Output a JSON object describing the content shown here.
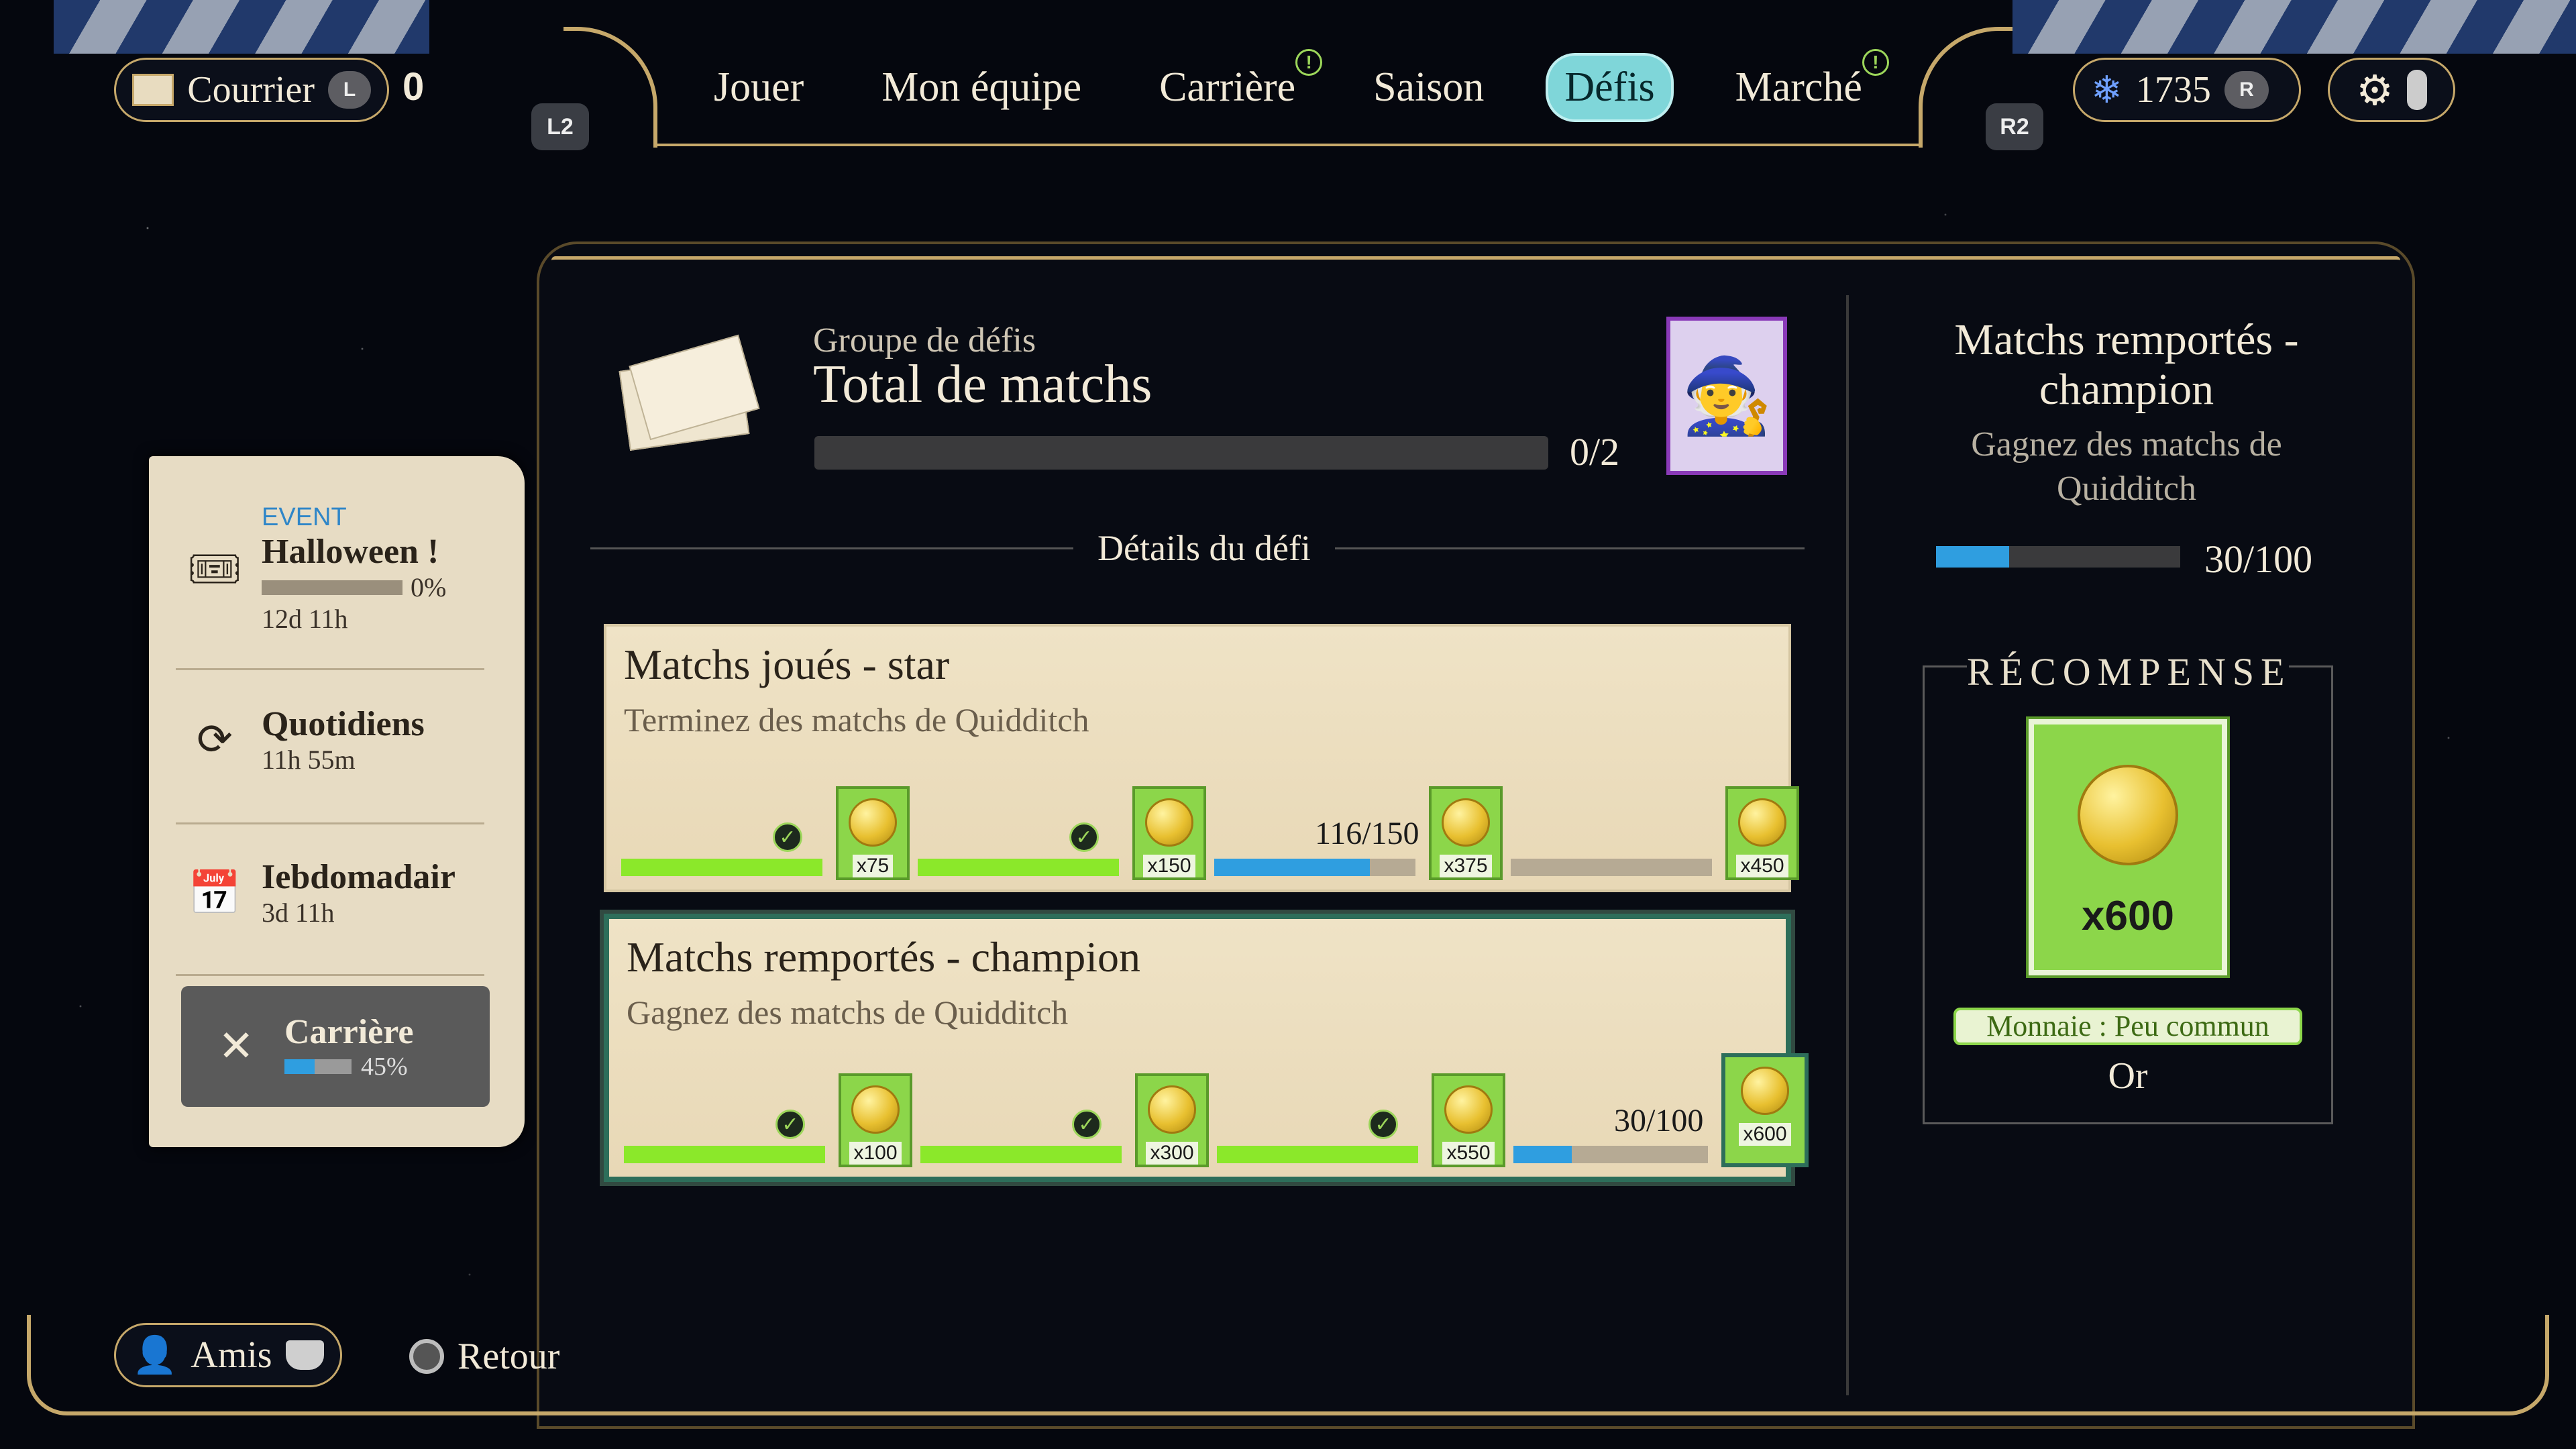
{
  "top": {
    "mail_label": "Courrier",
    "mail_btn": "L",
    "mail_count": "0",
    "l2": "L2",
    "r2": "R2",
    "currency_value": "1735",
    "currency_btn": "R",
    "currency_icon": "crystal-icon",
    "settings_icon": "gear-icon"
  },
  "nav": {
    "items": [
      {
        "label": "Jouer",
        "active": false,
        "notif": false
      },
      {
        "label": "Mon équipe",
        "active": false,
        "notif": false
      },
      {
        "label": "Carrière",
        "active": false,
        "notif": true
      },
      {
        "label": "Saison",
        "active": false,
        "notif": false
      },
      {
        "label": "Défis",
        "active": true,
        "notif": false
      },
      {
        "label": "Marché",
        "active": false,
        "notif": true
      }
    ],
    "notif_symbol": "!"
  },
  "sidebar": {
    "event_tag": "EVENT",
    "event_title": "Halloween !",
    "event_progress_text": "0%",
    "event_progress": 0,
    "event_time": "12d 11h",
    "daily_title": "Quotidiens",
    "daily_time": "11h 55m",
    "weekly_title": "Iebdomadair",
    "weekly_time": "3d 11h",
    "career_title": "Carrière",
    "career_progress_text": "45%",
    "career_progress": 0.45
  },
  "group": {
    "label": "Groupe de défis",
    "title": "Total de matchs",
    "progress_text": "0/2",
    "progress": 0
  },
  "details_label": "Détails du défi",
  "challenges": [
    {
      "title": "Matchs joués - star",
      "subtitle": "Terminez des matchs de Quidditch",
      "tiers": [
        {
          "reward": "x75",
          "progress": 1,
          "done": true,
          "text": ""
        },
        {
          "reward": "x150",
          "progress": 1,
          "done": true,
          "text": ""
        },
        {
          "reward": "x375",
          "progress": 0.773,
          "done": false,
          "text": "116/150"
        },
        {
          "reward": "x450",
          "progress": 0,
          "done": false,
          "text": ""
        }
      ]
    },
    {
      "title": "Matchs remportés - champion",
      "subtitle": "Gagnez des matchs de Quidditch",
      "tiers": [
        {
          "reward": "x100",
          "progress": 1,
          "done": true,
          "text": ""
        },
        {
          "reward": "x300",
          "progress": 1,
          "done": true,
          "text": ""
        },
        {
          "reward": "x550",
          "progress": 1,
          "done": true,
          "text": ""
        },
        {
          "reward": "x600",
          "progress": 0.3,
          "done": false,
          "text": "30/100"
        }
      ]
    }
  ],
  "detail": {
    "title": "Matchs remportés - champion",
    "subtitle": "Gagnez des matchs de Quidditch",
    "progress_text": "30/100",
    "progress": 0.3,
    "reward_header": "RÉCOMPENSE",
    "reward_amount": "x600",
    "reward_tag": "Monnaie : Peu commun",
    "reward_type": "Or"
  },
  "bottom": {
    "friends_label": "Amis",
    "back_label": "Retour"
  },
  "colors": {
    "gold_trim": "#c6a86a",
    "active_tab": "#7fd6d9",
    "progress_green": "#8be82a",
    "progress_blue": "#2f9ee0",
    "reward_green": "#8cd64a"
  }
}
